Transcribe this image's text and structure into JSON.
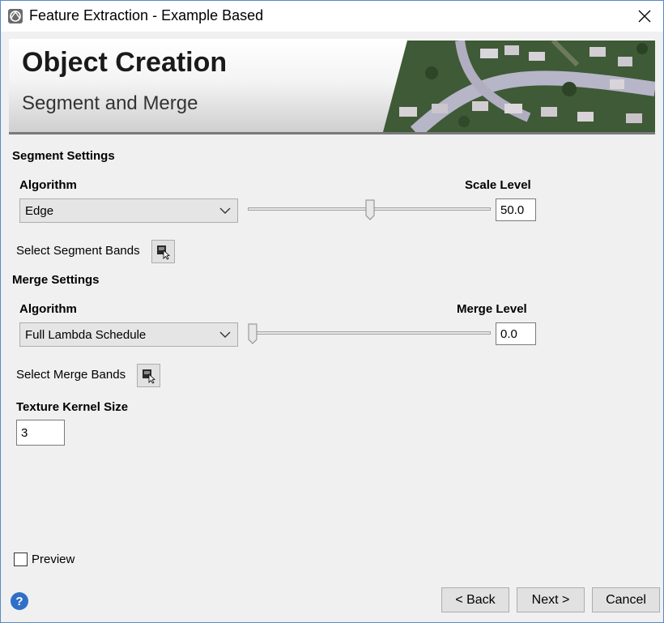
{
  "window": {
    "title": "Feature Extraction - Example Based",
    "app_icon": "envi-app-icon",
    "close_icon": "close-icon"
  },
  "banner": {
    "title": "Object Creation",
    "subtitle": "Segment and Merge"
  },
  "segment": {
    "section_title": "Segment Settings",
    "algorithm_label": "Algorithm",
    "algorithm_value": "Edge",
    "level_label": "Scale Level",
    "level_value": "50.0",
    "level_fraction": 0.5,
    "bands_label": "Select Segment Bands"
  },
  "merge": {
    "section_title": "Merge Settings",
    "algorithm_label": "Algorithm",
    "algorithm_value": "Full Lambda Schedule",
    "level_label": "Merge Level",
    "level_value": "0.0",
    "level_fraction": 0.0,
    "bands_label": "Select Merge Bands"
  },
  "texture": {
    "label": "Texture Kernel Size",
    "value": "3"
  },
  "preview": {
    "label": "Preview",
    "checked": false
  },
  "footer": {
    "help_icon": "?",
    "back_label": "< Back",
    "next_label": "Next >",
    "cancel_label": "Cancel"
  }
}
